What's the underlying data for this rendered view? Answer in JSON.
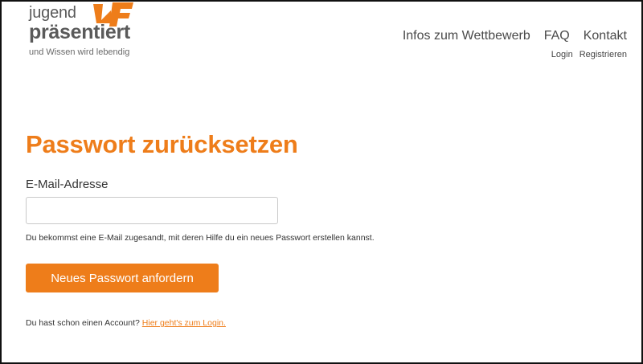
{
  "logo": {
    "line1": "jugend",
    "line2": "präsentiert",
    "tagline": "und Wissen wird lebendig",
    "accent_color": "#ee7d1a"
  },
  "nav": {
    "items": [
      "Infos zum Wettbewerb",
      "FAQ",
      "Kontakt"
    ],
    "sub_items": [
      "Login",
      "Registrieren"
    ]
  },
  "main": {
    "title": "Passwort zurücksetzen",
    "email_label": "E-Mail-Adresse",
    "email_value": "",
    "help_text": "Du bekommst eine E-Mail zugesandt, mit deren Hilfe du ein neues Passwort erstellen kannst.",
    "submit_label": "Neues Passwort anfordern",
    "account_prompt": "Du hast schon einen Account?",
    "login_link": "Hier geht's zum Login."
  },
  "colors": {
    "accent": "#ee7d1a",
    "text": "#444444"
  }
}
